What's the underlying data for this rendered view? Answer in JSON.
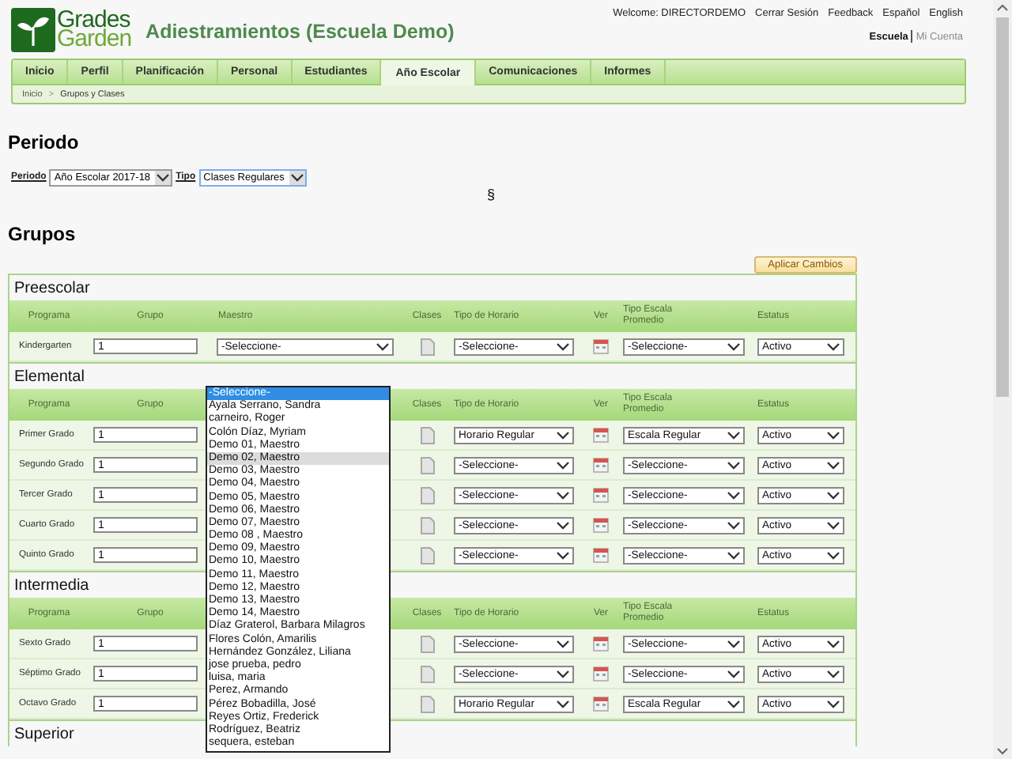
{
  "header": {
    "logo_lines": [
      "Grades",
      "Garden"
    ],
    "title": "Adiestramientos (Escuela Demo)",
    "user_links": [
      "Welcome: DIRECTORDEMO",
      "Cerrar Sesión",
      "Feedback",
      "Español",
      "English"
    ],
    "account_links": [
      {
        "label": "Escuela",
        "selected": true
      },
      {
        "label": "Mi Cuenta",
        "selected": false
      }
    ]
  },
  "tabs": [
    {
      "label": "Inicio",
      "selected": false
    },
    {
      "label": "Perfil",
      "selected": false
    },
    {
      "label": "Planificación",
      "selected": false
    },
    {
      "label": "Personal",
      "selected": false
    },
    {
      "label": "Estudiantes",
      "selected": false
    },
    {
      "label": "Año Escolar",
      "selected": true
    },
    {
      "label": "Comunicaciones",
      "selected": false
    },
    {
      "label": "Informes",
      "selected": false
    }
  ],
  "breadcrumb": {
    "items": [
      "Inicio",
      "Grupos y Clases"
    ],
    "separator": ">"
  },
  "periodo": {
    "heading": "Periodo",
    "filters": [
      {
        "label": "Periodo",
        "value": "Año Escolar 2017-18",
        "focused": false
      },
      {
        "label": "Tipo",
        "value": "Clases Regulares",
        "focused": true
      }
    ],
    "symbol": "§"
  },
  "grupos": {
    "heading": "Grupos",
    "apply_button": "Aplicar Cambios",
    "sections": [
      {
        "title": "Preescolar",
        "columns": [
          "Programa",
          "Grupo",
          "Maestro",
          "Clases",
          "Tipo de Horario",
          "Ver",
          "Tipo Escala Promedio",
          "Estatus"
        ],
        "rows": [
          {
            "programa": "Kindergarten",
            "grupo": "1",
            "maestro": "-Seleccione-",
            "tipo_horario": "-Seleccione-",
            "tipo_escala": "-Seleccione-",
            "estatus": "Activo"
          }
        ]
      },
      {
        "title": "Elemental",
        "columns": [
          "Programa",
          "Grupo",
          null,
          "Clases",
          "Tipo de Horario",
          "Ver",
          "Tipo Escala Promedio",
          "Estatus"
        ],
        "rows": [
          {
            "programa": "Primer Grado",
            "grupo": "1",
            "tipo_horario": "Horario Regular",
            "tipo_escala": "Escala Regular",
            "estatus": "Activo"
          },
          {
            "programa": "Segundo Grado",
            "grupo": "1",
            "tipo_horario": "-Seleccione-",
            "tipo_escala": "-Seleccione-",
            "estatus": "Activo"
          },
          {
            "programa": "Tercer Grado",
            "grupo": "1",
            "tipo_horario": "-Seleccione-",
            "tipo_escala": "-Seleccione-",
            "estatus": "Activo"
          },
          {
            "programa": "Cuarto Grado",
            "grupo": "1",
            "tipo_horario": "-Seleccione-",
            "tipo_escala": "-Seleccione-",
            "estatus": "Activo"
          },
          {
            "programa": "Quinto Grado",
            "grupo": "1",
            "tipo_horario": "-Seleccione-",
            "tipo_escala": "-Seleccione-",
            "estatus": "Activo"
          }
        ]
      },
      {
        "title": "Intermedia",
        "columns": [
          "Programa",
          "Grupo",
          null,
          "Clases",
          "Tipo de Horario",
          "Ver",
          "Tipo Escala Promedio",
          "Estatus"
        ],
        "rows": [
          {
            "programa": "Sexto Grado",
            "grupo": "1",
            "tipo_horario": "-Seleccione-",
            "tipo_escala": "-Seleccione-",
            "estatus": "Activo"
          },
          {
            "programa": "Séptimo Grado",
            "grupo": "1",
            "tipo_horario": "-Seleccione-",
            "tipo_escala": "-Seleccione-",
            "estatus": "Activo"
          },
          {
            "programa": "Octavo Grado",
            "grupo": "1",
            "tipo_horario": "Horario Regular",
            "tipo_escala": "Escala Regular",
            "estatus": "Activo"
          }
        ]
      },
      {
        "title": "Superior"
      }
    ]
  },
  "maestro_dropdown": [
    {
      "label": "-Seleccione-",
      "selected": true,
      "hovered": false
    },
    {
      "label": "Ayala Serrano, Sandra",
      "selected": false,
      "hovered": false
    },
    {
      "label": "carneiro, Roger",
      "selected": false,
      "hovered": false
    },
    {
      "label": "Colón Díaz, Myriam",
      "selected": false,
      "hovered": false
    },
    {
      "label": "Demo 01, Maestro",
      "selected": false,
      "hovered": false
    },
    {
      "label": "Demo 02, Maestro",
      "selected": false,
      "hovered": true
    },
    {
      "label": "Demo 03, Maestro",
      "selected": false,
      "hovered": false
    },
    {
      "label": "Demo 04, Maestro",
      "selected": false,
      "hovered": false
    },
    {
      "label": "Demo 05, Maestro",
      "selected": false,
      "hovered": false
    },
    {
      "label": "Demo 06, Maestro",
      "selected": false,
      "hovered": false
    },
    {
      "label": "Demo 07, Maestro",
      "selected": false,
      "hovered": false
    },
    {
      "label": "Demo 08 , Maestro",
      "selected": false,
      "hovered": false
    },
    {
      "label": "Demo 09, Maestro",
      "selected": false,
      "hovered": false
    },
    {
      "label": "Demo 10, Maestro",
      "selected": false,
      "hovered": false
    },
    {
      "label": "Demo 11, Maestro",
      "selected": false,
      "hovered": false
    },
    {
      "label": "Demo 12, Maestro",
      "selected": false,
      "hovered": false
    },
    {
      "label": "Demo 13, Maestro",
      "selected": false,
      "hovered": false
    },
    {
      "label": "Demo 14, Maestro",
      "selected": false,
      "hovered": false
    },
    {
      "label": "Díaz Graterol, Barbara Milagros",
      "selected": false,
      "hovered": false
    },
    {
      "label": "Flores Colón, Amarilis",
      "selected": false,
      "hovered": false
    },
    {
      "label": "Hernández González, Liliana",
      "selected": false,
      "hovered": false
    },
    {
      "label": "jose prueba, pedro",
      "selected": false,
      "hovered": false
    },
    {
      "label": "luisa, maria",
      "selected": false,
      "hovered": false
    },
    {
      "label": "Perez, Armando",
      "selected": false,
      "hovered": false
    },
    {
      "label": "Pérez Bobadilla, José",
      "selected": false,
      "hovered": false
    },
    {
      "label": "Reyes Ortiz, Frederick",
      "selected": false,
      "hovered": false
    },
    {
      "label": "Rodríguez, Beatriz",
      "selected": false,
      "hovered": false
    },
    {
      "label": "sequera, esteban",
      "selected": false,
      "hovered": false
    }
  ]
}
